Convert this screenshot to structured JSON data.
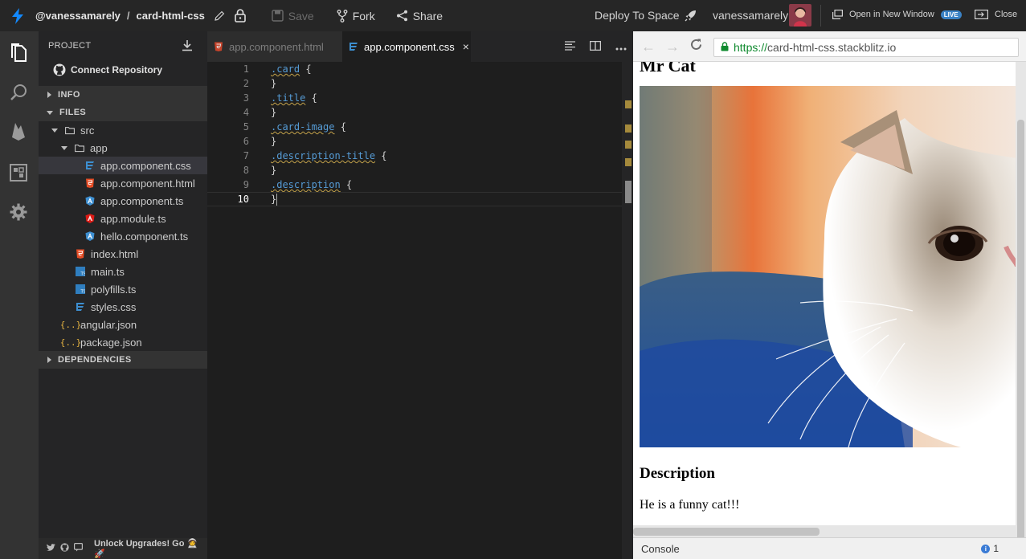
{
  "topbar": {
    "owner": "@vanessamarely",
    "separator": "/",
    "project": "card-html-css",
    "save_label": "Save",
    "fork_label": "Fork",
    "share_label": "Share",
    "deploy_label": "Deploy To Space",
    "username": "vanessamarely",
    "open_window_label": "Open in New Window",
    "live_badge": "LIVE",
    "close_label": "Close"
  },
  "sidebar": {
    "header": "PROJECT",
    "connect_repo": "Connect Repository",
    "sections": {
      "info": "INFO",
      "files": "FILES",
      "dependencies": "DEPENDENCIES"
    },
    "tree": [
      {
        "label": "src",
        "icon": "folder-icon"
      },
      {
        "label": "app",
        "icon": "folder-icon"
      },
      {
        "label": "app.component.css",
        "icon": "css-file-icon"
      },
      {
        "label": "app.component.html",
        "icon": "html-file-icon"
      },
      {
        "label": "app.component.ts",
        "icon": "angular-file-icon"
      },
      {
        "label": "app.module.ts",
        "icon": "angular-file-icon"
      },
      {
        "label": "hello.component.ts",
        "icon": "angular-file-icon"
      },
      {
        "label": "index.html",
        "icon": "html-file-icon"
      },
      {
        "label": "main.ts",
        "icon": "ts-file-icon"
      },
      {
        "label": "polyfills.ts",
        "icon": "ts-file-icon"
      },
      {
        "label": "styles.css",
        "icon": "css-file-icon"
      },
      {
        "label": "angular.json",
        "icon": "json-file-icon"
      },
      {
        "label": "package.json",
        "icon": "json-file-icon"
      }
    ],
    "footer_text": "Unlock Upgrades! Go",
    "footer_emoji": "🧑‍🚀🚀"
  },
  "editor": {
    "tabs": [
      {
        "label": "app.component.html",
        "active": false
      },
      {
        "label": "app.component.css",
        "active": true
      }
    ],
    "close_glyph": "×",
    "lines": [
      {
        "num": "1",
        "selector": ".card",
        "brace": " {"
      },
      {
        "num": "2",
        "selector": "",
        "brace": "}"
      },
      {
        "num": "3",
        "selector": ".title",
        "brace": " {"
      },
      {
        "num": "4",
        "selector": "",
        "brace": "}"
      },
      {
        "num": "5",
        "selector": ".card-image",
        "brace": " {"
      },
      {
        "num": "6",
        "selector": "",
        "brace": "}"
      },
      {
        "num": "7",
        "selector": ".description-title",
        "brace": " {"
      },
      {
        "num": "8",
        "selector": "",
        "brace": "}"
      },
      {
        "num": "9",
        "selector": ".description",
        "brace": " {"
      },
      {
        "num": "10",
        "selector": "",
        "brace": "}"
      }
    ],
    "current_line": 10
  },
  "preview": {
    "url_scheme": "https://",
    "url_host": "card-html-css.stackblitz.io",
    "card_title": "Mr Cat",
    "description_title": "Description",
    "description": "He is a funny cat!!!",
    "console_label": "Console",
    "console_count": "1"
  },
  "colors": {
    "accent": "#1389fd",
    "keyword": "#569cd6",
    "squiggle": "#c3a24a",
    "https_green": "#0f8a2e"
  }
}
